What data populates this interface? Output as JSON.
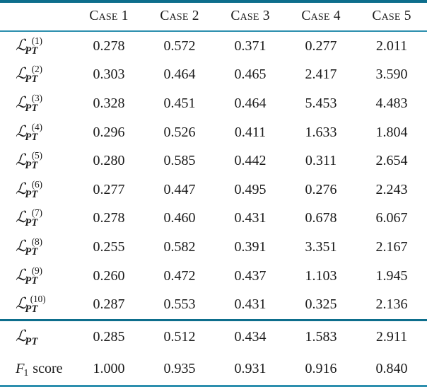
{
  "table": {
    "columns": [
      {
        "label": "Case 1",
        "name": "case-1"
      },
      {
        "label": "Case 2",
        "name": "case-2"
      },
      {
        "label": "Case 3",
        "name": "case-3"
      },
      {
        "label": "Case 4",
        "name": "case-4"
      },
      {
        "label": "Case 5",
        "name": "case-5"
      }
    ],
    "corner_label": "",
    "rows": [
      {
        "symbol": "L",
        "subscript": "PT",
        "superscript": "(1)",
        "values": [
          "0.278",
          "0.572",
          "0.371",
          "0.277",
          "2.011"
        ]
      },
      {
        "symbol": "L",
        "subscript": "PT",
        "superscript": "(2)",
        "values": [
          "0.303",
          "0.464",
          "0.465",
          "2.417",
          "3.590"
        ]
      },
      {
        "symbol": "L",
        "subscript": "PT",
        "superscript": "(3)",
        "values": [
          "0.328",
          "0.451",
          "0.464",
          "5.453",
          "4.483"
        ]
      },
      {
        "symbol": "L",
        "subscript": "PT",
        "superscript": "(4)",
        "values": [
          "0.296",
          "0.526",
          "0.411",
          "1.633",
          "1.804"
        ]
      },
      {
        "symbol": "L",
        "subscript": "PT",
        "superscript": "(5)",
        "values": [
          "0.280",
          "0.585",
          "0.442",
          "0.311",
          "2.654"
        ]
      },
      {
        "symbol": "L",
        "subscript": "PT",
        "superscript": "(6)",
        "values": [
          "0.277",
          "0.447",
          "0.495",
          "0.276",
          "2.243"
        ]
      },
      {
        "symbol": "L",
        "subscript": "PT",
        "superscript": "(7)",
        "values": [
          "0.278",
          "0.460",
          "0.431",
          "0.678",
          "6.067"
        ]
      },
      {
        "symbol": "L",
        "subscript": "PT",
        "superscript": "(8)",
        "values": [
          "0.255",
          "0.582",
          "0.391",
          "3.351",
          "2.167"
        ]
      },
      {
        "symbol": "L",
        "subscript": "PT",
        "superscript": "(9)",
        "values": [
          "0.260",
          "0.472",
          "0.437",
          "1.103",
          "1.945"
        ]
      },
      {
        "symbol": "L",
        "subscript": "PT",
        "superscript": "(10)",
        "values": [
          "0.287",
          "0.553",
          "0.431",
          "0.325",
          "2.136"
        ]
      }
    ],
    "summary_rows": [
      {
        "kind": "loss",
        "symbol": "L",
        "subscript": "PT",
        "superscript": "",
        "values": [
          "0.285",
          "0.512",
          "0.434",
          "1.583",
          "2.911"
        ]
      },
      {
        "kind": "f1",
        "symbol": "F",
        "subscript": "1",
        "word": "score",
        "values": [
          "1.000",
          "0.935",
          "0.931",
          "0.916",
          "0.840"
        ]
      }
    ],
    "colors": {
      "rule_dark": "#0d6e8c",
      "rule_light": "#2d8fae",
      "text": "#1a1a1a",
      "background": "#ffffff"
    }
  }
}
